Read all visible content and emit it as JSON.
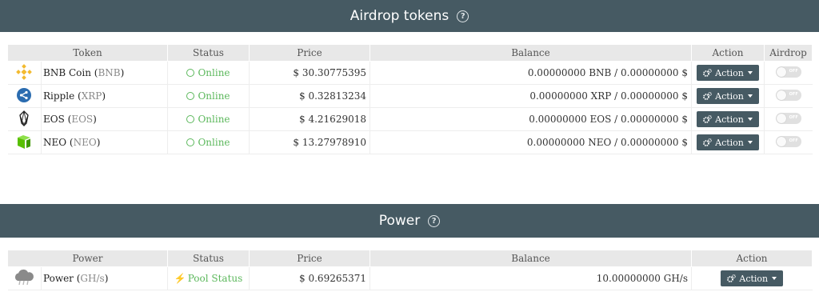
{
  "airdrop_section": {
    "title": "Airdrop tokens",
    "help": "?"
  },
  "tokens_table": {
    "headers": {
      "token": "Token",
      "status": "Status",
      "price": "Price",
      "balance": "Balance",
      "action": "Action",
      "airdrop": "Airdrop"
    },
    "rows": [
      {
        "icon": "binance-coin-icon",
        "name": "BNB Coin",
        "symbol": "BNB",
        "status": "Online",
        "price": "$ 30.30775395",
        "balance": "0.00000000 BNB / 0.00000000 $",
        "action": "Action",
        "airdrop": "OFF"
      },
      {
        "icon": "ripple-icon",
        "name": "Ripple",
        "symbol": "XRP",
        "status": "Online",
        "price": "$ 0.32813234",
        "balance": "0.00000000 XRP / 0.00000000 $",
        "action": "Action",
        "airdrop": "OFF"
      },
      {
        "icon": "eos-icon",
        "name": "EOS",
        "symbol": "EOS",
        "status": "Online",
        "price": "$ 4.21629018",
        "balance": "0.00000000 EOS / 0.00000000 $",
        "action": "Action",
        "airdrop": "OFF"
      },
      {
        "icon": "neo-icon",
        "name": "NEO",
        "symbol": "NEO",
        "status": "Online",
        "price": "$ 13.27978910",
        "balance": "0.00000000 NEO / 0.00000000 $",
        "action": "Action",
        "airdrop": "OFF"
      }
    ]
  },
  "power_section": {
    "title": "Power",
    "help": "?"
  },
  "power_table": {
    "headers": {
      "power": "Power",
      "status": "Status",
      "price": "Price",
      "balance": "Balance",
      "action": "Action"
    },
    "rows": [
      {
        "icon": "cloud-icon",
        "name": "Power",
        "unit": "GH/s",
        "status": "Pool Status",
        "price": "$ 0.69265371",
        "balance": "10.00000000 GH/s",
        "action": "Action"
      }
    ]
  },
  "colors": {
    "header_bg": "#465a63",
    "online": "#5cb85c",
    "button_bg": "#465a63",
    "bnb": "#f3ba2f",
    "xrp": "#23292f",
    "neo": "#58bf00"
  }
}
